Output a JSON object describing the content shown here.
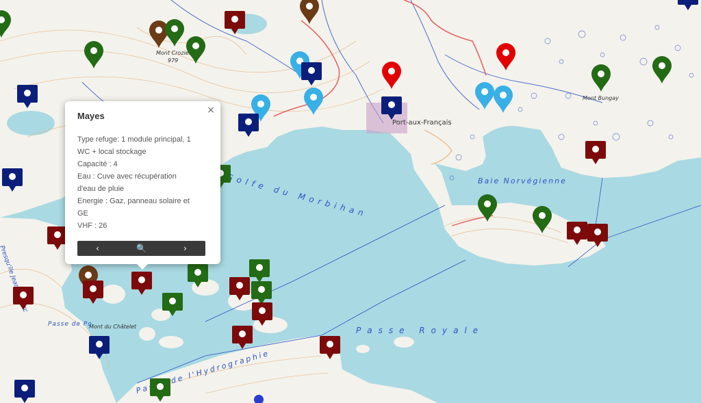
{
  "map": {
    "place_labels": [
      "Mont Crozier",
      "979",
      "Mont Bungay",
      "Port-aux-Français",
      "Baie Norvégienne",
      "Golfe du Morbihan",
      "Passe Royale",
      "Passe de l'Hydrographie",
      "Mont du Châtelet",
      "Passe de Po",
      "Presqu'île Jeanne d'Arc"
    ],
    "colors": {
      "sea": "#a9d9e3",
      "land": "#f4f2ec",
      "contour": "#e2b98c",
      "boundary": "#2d55c4",
      "route_red": "#e06666",
      "marker_navy": "#0b1f7a",
      "marker_maroon": "#7c0a0a",
      "marker_green": "#236b15",
      "marker_brown": "#6b3b18",
      "marker_red": "#e30000",
      "marker_lightblue": "#38b0e6"
    },
    "markers": [
      {
        "type": "balloon",
        "color": "green",
        "icon": "refuge-marker-icon"
      },
      {
        "type": "balloon",
        "color": "brown",
        "icon": "refuge-marker-icon"
      },
      {
        "type": "balloon",
        "color": "red",
        "icon": "refuge-marker-icon"
      },
      {
        "type": "balloon",
        "color": "lightblue",
        "icon": "refuge-marker-icon"
      },
      {
        "type": "square",
        "color": "navy",
        "icon": "refuge-marker-icon"
      },
      {
        "type": "square",
        "color": "maroon",
        "icon": "refuge-marker-icon"
      },
      {
        "type": "square",
        "color": "green",
        "icon": "refuge-marker-icon"
      }
    ]
  },
  "popup": {
    "title": "Mayes",
    "close": "×",
    "lines": [
      "Type refuge: 1 module principal, 1",
      "WC + local stockage",
      "Capacité : 4",
      "Eau : Cuve avec récupération",
      "d'eau de pluie",
      "Energie : Gaz, panneau solaire et",
      "GE",
      "VHF : 26"
    ],
    "nav": {
      "prev": "‹",
      "zoom": "🔍",
      "next": "›"
    }
  }
}
